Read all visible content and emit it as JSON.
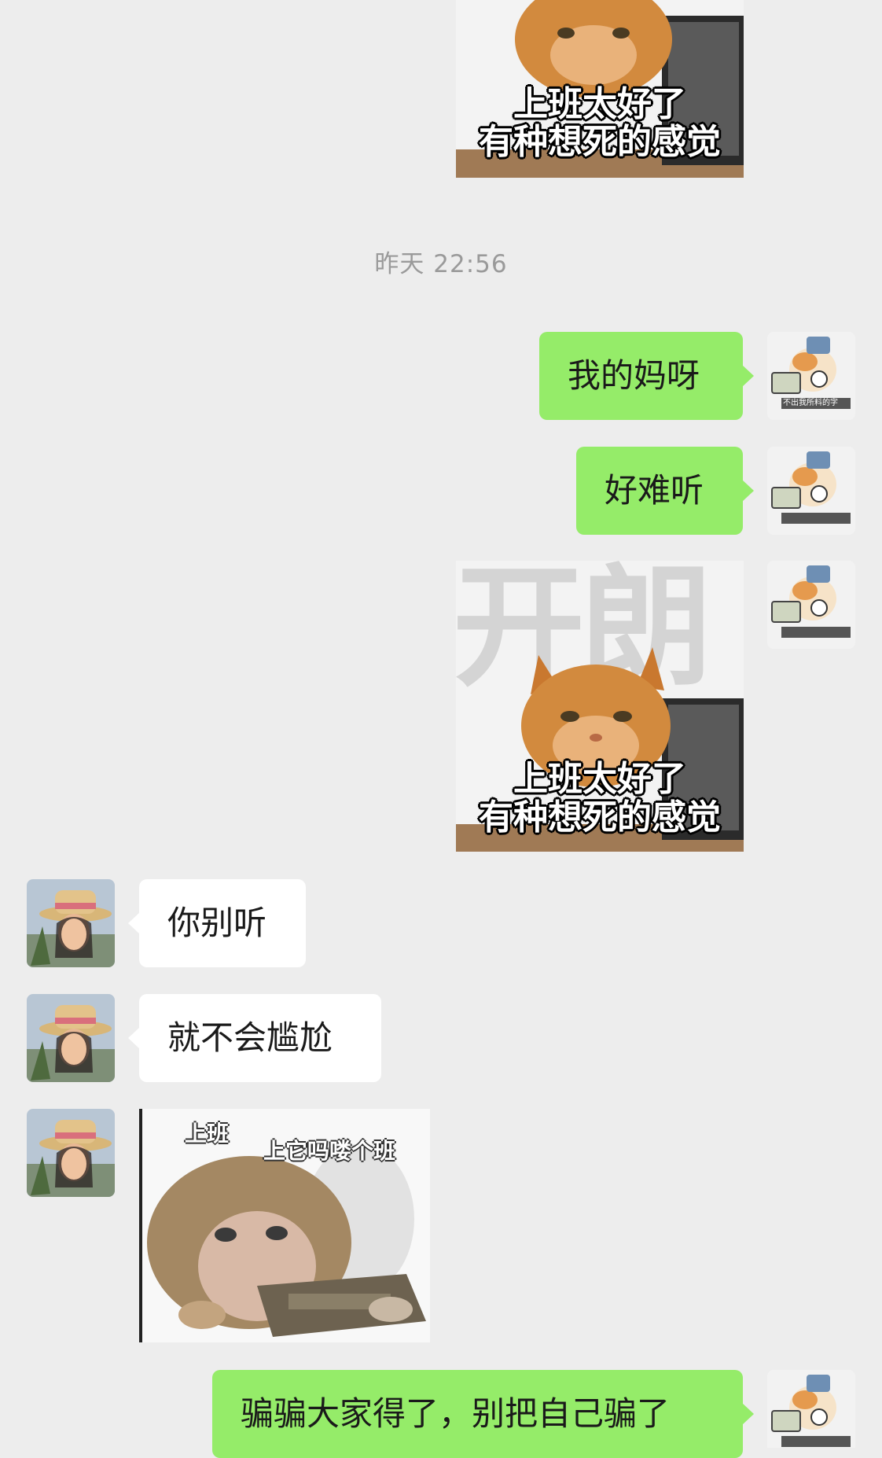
{
  "timestamp": "昨天 22:56",
  "messages": {
    "m1": "我的妈呀",
    "m2": "好难听",
    "m3": "你别听",
    "m4": "就不会尴尬",
    "m5": "骗骗大家得了，别把自己骗了"
  },
  "stickers": {
    "cat": {
      "big_text": "开朗",
      "caption_line1": "上班太好了",
      "caption_line2": "有种想死的感觉"
    },
    "monkey": {
      "caption_left": "上班",
      "caption_right": "上它吗喽个班"
    }
  },
  "self_avatar": {
    "caption": "不出我所料的字"
  },
  "colors": {
    "background": "#ededed",
    "outgoing_bubble": "#95ec69",
    "incoming_bubble": "#ffffff",
    "timestamp_text": "#9a9a9a"
  }
}
